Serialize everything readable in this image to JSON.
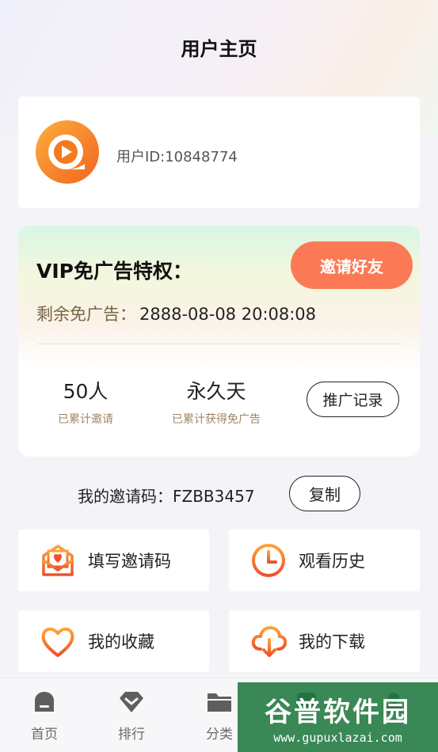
{
  "header": {
    "title": "用户主页"
  },
  "user": {
    "id_text": "用户ID:10848774"
  },
  "vip": {
    "title": "VIP免广告特权：",
    "invite_button": "邀请好友",
    "remain_label": "剩余免广告：",
    "remain_value": "2888-08-08 20:08:08",
    "stats": [
      {
        "value": "50人",
        "label": "已累计邀请"
      },
      {
        "value": "永久天",
        "label": "已累计获得免广告"
      }
    ],
    "record_button": "推广记录"
  },
  "invite_code": {
    "text": "我的邀请码：FZBB3457",
    "copy_button": "复制"
  },
  "tiles": [
    {
      "label": "填写邀请码",
      "icon": "envelope-heart-icon"
    },
    {
      "label": "观看历史",
      "icon": "clock-icon"
    },
    {
      "label": "我的收藏",
      "icon": "heart-icon"
    },
    {
      "label": "我的下载",
      "icon": "cloud-download-icon"
    }
  ],
  "tabbar": {
    "items": [
      {
        "label": "首页",
        "icon": "home-icon"
      },
      {
        "label": "排行",
        "icon": "rank-icon"
      },
      {
        "label": "分类",
        "icon": "folder-icon"
      },
      {
        "label": "",
        "icon": "tab-icon"
      },
      {
        "label": "",
        "icon": "user-icon"
      }
    ]
  },
  "watermark": {
    "text": "谷普软件园",
    "url": "www.gupuxlazai.com"
  },
  "colors": {
    "accent": "#fb7a55",
    "orange": "#f57a1e",
    "icon_gradient_top": "#fca33a",
    "icon_gradient_bottom": "#f0512a"
  }
}
